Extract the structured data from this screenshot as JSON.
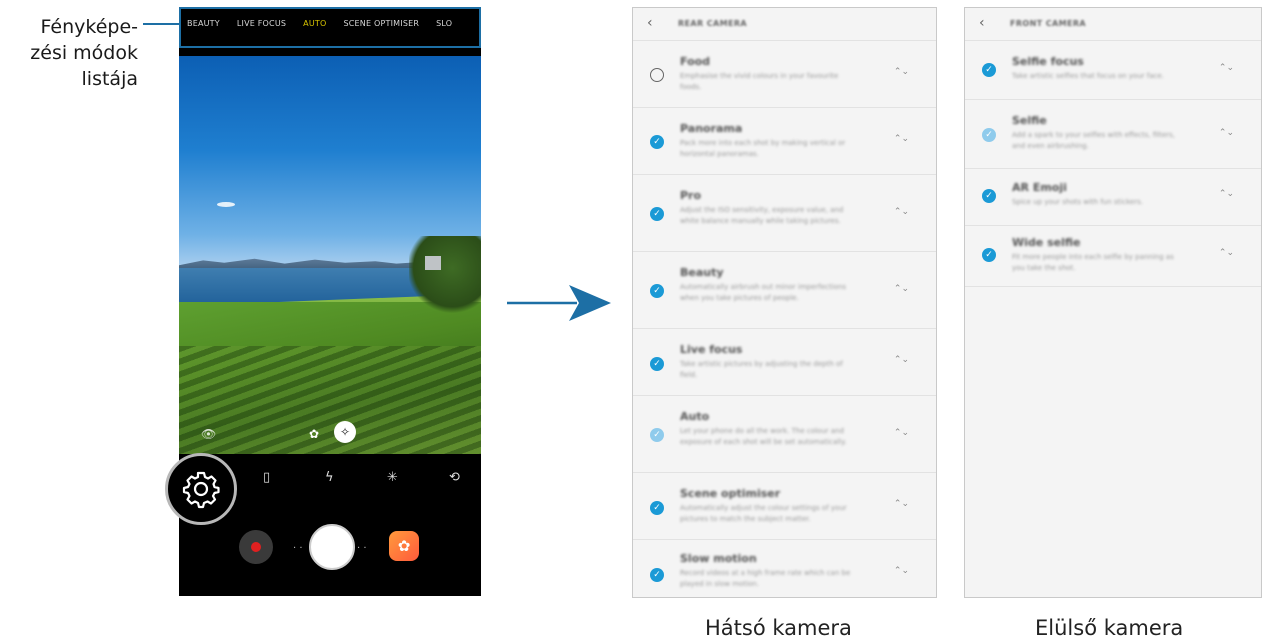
{
  "callout": {
    "lines": [
      "Fényképe-",
      "zési módok",
      "listája"
    ]
  },
  "phone": {
    "modes": [
      "BEAUTY",
      "LIVE FOCUS",
      "AUTO",
      "SCENE OPTIMISER",
      "SLO"
    ],
    "active_mode": "AUTO",
    "colors": {
      "accent": "#d8c400",
      "frame": "#1d6fa5"
    }
  },
  "rear_camera": {
    "title": "REAR CAMERA",
    "modes": [
      {
        "name": "Food",
        "desc": "Emphasise the vivid colours in your favourite foods.",
        "state": "unchecked"
      },
      {
        "name": "Panorama",
        "desc": "Pack more into each shot by making vertical or horizontal panoramas.",
        "state": "checked"
      },
      {
        "name": "Pro",
        "desc": "Adjust the ISO sensitivity, exposure value, and white balance manually while taking pictures.",
        "state": "checked"
      },
      {
        "name": "Beauty",
        "desc": "Automatically airbrush out minor imperfections when you take pictures of people.",
        "state": "checked"
      },
      {
        "name": "Live focus",
        "desc": "Take artistic pictures by adjusting the depth of field.",
        "state": "checked"
      },
      {
        "name": "Auto",
        "desc": "Let your phone do all the work. The colour and exposure of each shot will be set automatically.",
        "state": "locked"
      },
      {
        "name": "Scene optimiser",
        "desc": "Automatically adjust the colour settings of your pictures to match the subject matter.",
        "state": "checked"
      },
      {
        "name": "Slow motion",
        "desc": "Record videos at a high frame rate which can be played in slow motion.",
        "state": "checked"
      }
    ]
  },
  "front_camera": {
    "title": "FRONT CAMERA",
    "modes": [
      {
        "name": "Selfie focus",
        "desc": "Take artistic selfies that focus on your face.",
        "state": "checked"
      },
      {
        "name": "Selfie",
        "desc": "Add a spark to your selfies with effects, filters, and even airbrushing.",
        "state": "locked"
      },
      {
        "name": "AR Emoji",
        "desc": "Spice up your shots with fun stickers.",
        "state": "checked"
      },
      {
        "name": "Wide selfie",
        "desc": "Fit more people into each selfie by panning as you take the shot.",
        "state": "checked"
      }
    ]
  },
  "captions": {
    "rear": "Hátsó kamera",
    "front": "Elülső kamera"
  }
}
